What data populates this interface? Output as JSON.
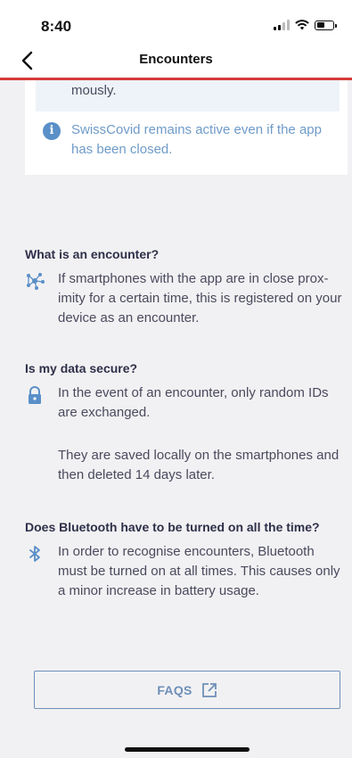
{
  "status_bar": {
    "time": "8:40"
  },
  "nav": {
    "title": "Encounters"
  },
  "card": {
    "truncated_text": "mously.",
    "info_text": "SwissCovid remains active even if the app has been closed."
  },
  "sections": [
    {
      "title": "What is an encounter?",
      "icon": "network-nodes-icon",
      "text": "If smartphones with the app are in close prox-imity for a certain time, this is registered on your device as an encounter."
    },
    {
      "title": "Is my data secure?",
      "icon": "lock-icon",
      "text": "In the event of an encounter, only random IDs are exchanged.",
      "text2": "They are saved locally on the smartphones and then deleted 14 days later."
    },
    {
      "title": "Does Bluetooth have to be turned on all the time?",
      "icon": "bluetooth-icon",
      "text": "In order to recognise encounters, Bluetooth must be turned on at all times. This causes only a minor increase in battery usage."
    }
  ],
  "faq_button": {
    "label": "FAQS",
    "icon": "external-link-icon"
  },
  "colors": {
    "accent_red": "#d63a3a",
    "info_blue": "#6f9bc8",
    "button_blue": "#6f8fb8"
  }
}
